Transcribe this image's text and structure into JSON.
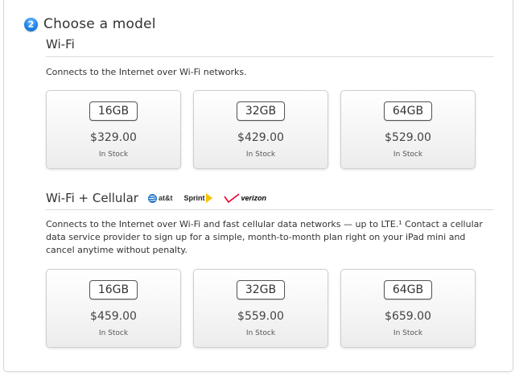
{
  "step": {
    "number": "2",
    "title": "Choose a model"
  },
  "wifi": {
    "title": "Wi-Fi",
    "description": "Connects to the Internet over Wi-Fi networks.",
    "models": [
      {
        "capacity": "16GB",
        "price": "$329.00",
        "availability": "In Stock"
      },
      {
        "capacity": "32GB",
        "price": "$429.00",
        "availability": "In Stock"
      },
      {
        "capacity": "64GB",
        "price": "$529.00",
        "availability": "In Stock"
      }
    ]
  },
  "cellular": {
    "title": "Wi-Fi + Cellular",
    "carriers": {
      "att": "at&t",
      "sprint": "Sprint",
      "verizon": "verizon"
    },
    "description": "Connects to the Internet over Wi-Fi and fast cellular data networks — up to LTE.¹ Contact a cellular data service provider to sign up for a simple, month-to-month plan right on your iPad mini and cancel anytime without penalty.",
    "models": [
      {
        "capacity": "16GB",
        "price": "$459.00",
        "availability": "In Stock"
      },
      {
        "capacity": "32GB",
        "price": "$559.00",
        "availability": "In Stock"
      },
      {
        "capacity": "64GB",
        "price": "$659.00",
        "availability": "In Stock"
      }
    ]
  },
  "colors": {
    "step_badge": "#2a8cf0",
    "sprint_yellow": "#f5c300",
    "verizon_red": "#e4002b",
    "att_blue": "#1a6fc4"
  },
  "icons": {
    "att": "att-globe-icon",
    "sprint": "sprint-wing-icon",
    "verizon": "verizon-check-icon"
  }
}
